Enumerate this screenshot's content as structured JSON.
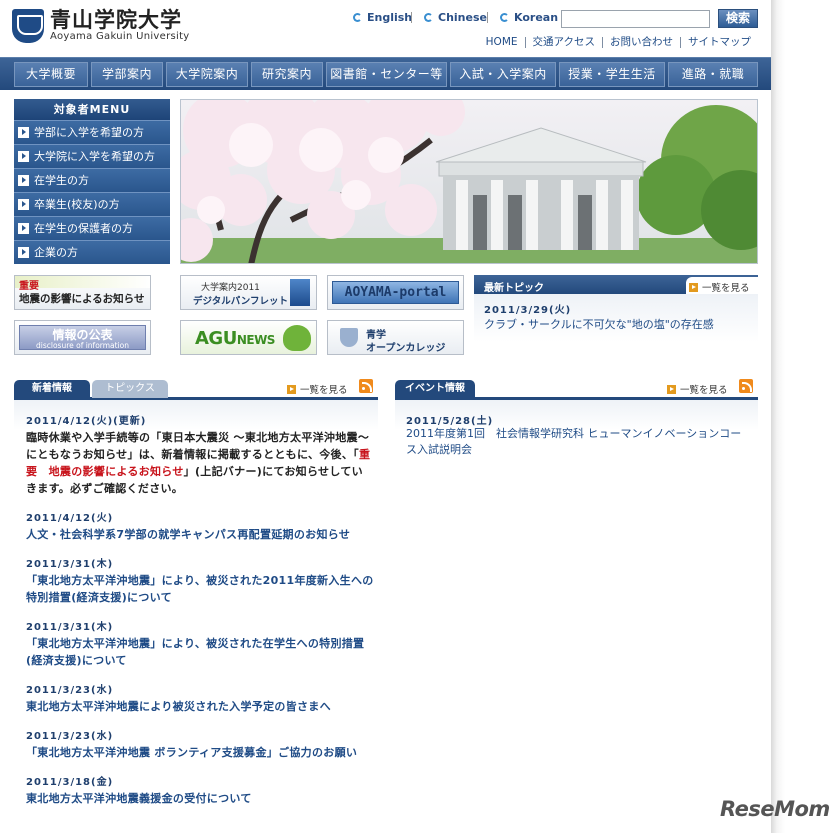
{
  "header": {
    "logo_jp": "青山学院大学",
    "logo_en": "Aoyama Gakuin University",
    "languages": [
      "English",
      "Chinese",
      "Korean"
    ],
    "search_placeholder": "",
    "search_button": "検索",
    "util_links": [
      "HOME",
      "交通アクセス",
      "お問い合わせ",
      "サイトマップ"
    ]
  },
  "gnav": [
    "大学概要",
    "学部案内",
    "大学院案内",
    "研究案内",
    "図書館・センター等",
    "入試・入学案内",
    "授業・学生生活",
    "進路・就職"
  ],
  "menu": {
    "title": "対象者MENU",
    "items": [
      "学部に入学を希望の方",
      "大学院に入学を希望の方",
      "在学生の方",
      "卒業生(校友)の方",
      "在学生の保護者の方",
      "企業の方"
    ]
  },
  "banners": {
    "important_tag": "重要",
    "important_text": "地震の影響によるお知らせ",
    "pamphlet_line1": "大学案内2011",
    "pamphlet_line2": "デジタルパンフレット",
    "portal": "AOYAMA-portal",
    "disclosure_jp": "情報の公表",
    "disclosure_en": "disclosure of information",
    "agu_a": "AGU",
    "agu_b": "NEWS",
    "college_line1": "青学",
    "college_line2": "オープンカレッジ"
  },
  "topic": {
    "title": "最新トピック",
    "more": "一覧を見る",
    "date": "2011/3/29(火)",
    "text": "クラブ・サークルに不可欠な\"地の塩\"の存在感"
  },
  "news": {
    "tab_active": "新着情報",
    "tab_inactive": "トピックス",
    "more": "一覧を見る",
    "featured_date": "2011/4/12(火)(更新)",
    "featured_p1": "臨時休業や入学手続等の「東日本大震災 〜東北地方太平洋沖地震〜 にともなうお知らせ」は、新着情報に掲載するとともに、今後、「",
    "featured_red": "重要　地震の影響によるお知らせ",
    "featured_p2": "」(上記バナー)にてお知らせしていきます。必ずご確認ください。",
    "items": [
      {
        "date": "2011/4/12(火)",
        "text": "人文・社会科学系7学部の就学キャンパス再配置延期のお知らせ"
      },
      {
        "date": "2011/3/31(木)",
        "text": "「東北地方太平洋沖地震」により、被災された2011年度新入生への特別措置(経済支援)について"
      },
      {
        "date": "2011/3/31(木)",
        "text": "「東北地方太平洋沖地震」により、被災された在学生への特別措置(経済支援)について"
      },
      {
        "date": "2011/3/23(水)",
        "text": "東北地方太平洋沖地震により被災された入学予定の皆さまへ"
      },
      {
        "date": "2011/3/23(水)",
        "text": "「東北地方太平洋沖地震 ボランティア支援募金」ご協力のお願い"
      },
      {
        "date": "2011/3/18(金)",
        "text": "東北地方太平洋沖地震義援金の受付について"
      }
    ]
  },
  "events": {
    "title": "イベント情報",
    "more": "一覧を見る",
    "date": "2011/5/28(土)",
    "text": "2011年度第1回　社会情報学研究科 ヒューマンイノベーションコース入試説明会"
  },
  "watermark": "ReseMom"
}
